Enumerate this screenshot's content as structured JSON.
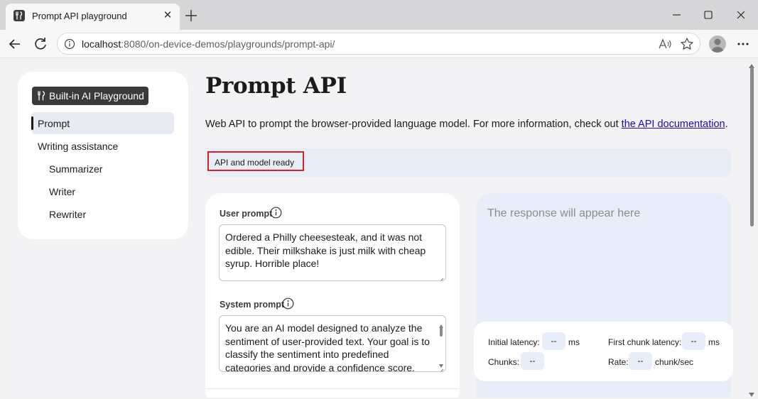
{
  "browser": {
    "tab_title": "Prompt API playground",
    "url_host": "localhost",
    "url_path": ":8080/on-device-demos/playgrounds/prompt-api/"
  },
  "sidebar": {
    "logo_label": "Built-in AI Playground",
    "items": [
      {
        "label": "Prompt",
        "active": true
      },
      {
        "label": "Writing assistance"
      },
      {
        "label": "Summarizer"
      },
      {
        "label": "Writer"
      },
      {
        "label": "Rewriter"
      }
    ]
  },
  "main": {
    "title": "Prompt API",
    "description": "Web API to prompt the browser-provided language model. For more information, check out ",
    "description_link": "the API documentation",
    "description_end": ".",
    "status": "API and model ready"
  },
  "form": {
    "user_prompt_label": "User prompt",
    "user_prompt_value": "Ordered a Philly cheesesteak, and it was not edible. Their milkshake is just milk with cheap syrup. Horrible place!",
    "system_prompt_label": "System prompt",
    "system_prompt_value": "You are an AI model designed to analyze the sentiment of user-provided text. Your goal is to classify the sentiment into predefined categories and provide a confidence score."
  },
  "response": {
    "placeholder": "The response will appear here"
  },
  "stats": {
    "initial_latency_label": "Initial latency:",
    "initial_latency_value": "--",
    "initial_latency_unit": "ms",
    "first_chunk_label": "First chunk latency:",
    "first_chunk_value": "--",
    "first_chunk_unit": "ms",
    "chunks_label": "Chunks:",
    "chunks_value": "--",
    "rate_label": "Rate:",
    "rate_value": "--",
    "rate_unit": "chunk/sec"
  },
  "colors": {
    "status_highlight": "#d8202b",
    "link": "#1a0dab",
    "response_bg": "#e8eef9"
  }
}
